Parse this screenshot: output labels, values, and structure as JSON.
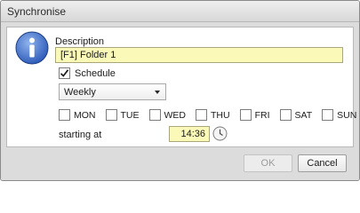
{
  "window": {
    "title": "Synchronise"
  },
  "icons": {
    "info": "info-icon",
    "check": "check-icon",
    "dropdown": "chevron-down-icon",
    "clock": "clock-icon"
  },
  "colors": {
    "input_bg": "#fbf9b8",
    "icon_blue": "#2f63c4"
  },
  "description": {
    "label": "Description",
    "value": "[F1] Folder 1"
  },
  "schedule": {
    "label": "Schedule",
    "checked": true
  },
  "frequency": {
    "selected": "Weekly"
  },
  "days": [
    {
      "label": "MON",
      "checked": false
    },
    {
      "label": "TUE",
      "checked": false
    },
    {
      "label": "WED",
      "checked": false
    },
    {
      "label": "THU",
      "checked": false
    },
    {
      "label": "FRI",
      "checked": false
    },
    {
      "label": "SAT",
      "checked": false
    },
    {
      "label": "SUN",
      "checked": false
    }
  ],
  "start": {
    "label": "starting at",
    "time": "14:36"
  },
  "buttons": {
    "ok": "OK",
    "cancel": "Cancel",
    "ok_enabled": false
  }
}
